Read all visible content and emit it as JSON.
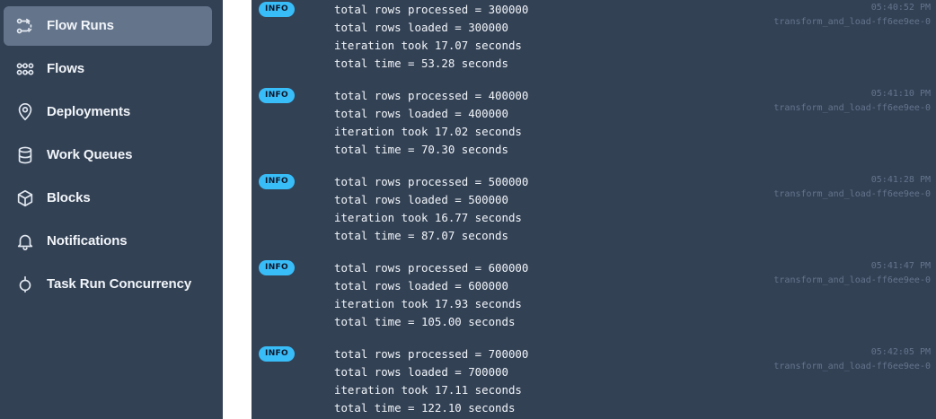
{
  "sidebar": {
    "items": [
      {
        "label": "Flow Runs",
        "icon": "flow-runs-icon",
        "active": true
      },
      {
        "label": "Flows",
        "icon": "flows-icon",
        "active": false
      },
      {
        "label": "Deployments",
        "icon": "map-pin-icon",
        "active": false
      },
      {
        "label": "Work Queues",
        "icon": "database-icon",
        "active": false
      },
      {
        "label": "Blocks",
        "icon": "cube-icon",
        "active": false
      },
      {
        "label": "Notifications",
        "icon": "bell-icon",
        "active": false
      },
      {
        "label": "Task Run Concurrency",
        "icon": "concurrency-icon",
        "active": false
      }
    ]
  },
  "colors": {
    "sidebar_bg": "#334155",
    "active_item_bg": "#64748b",
    "log_bg": "#334155",
    "badge_bg": "#38bdf8",
    "meta_text": "#64748b"
  },
  "logs": [
    {
      "level": "INFO",
      "time": "05:40:52 PM",
      "task": "transform_and_load-ff6ee9ee-0",
      "lines": [
        "total rows processed = 300000",
        "total rows loaded = 300000",
        "iteration took 17.07 seconds",
        "total time = 53.28 seconds"
      ]
    },
    {
      "level": "INFO",
      "time": "05:41:10 PM",
      "task": "transform_and_load-ff6ee9ee-0",
      "lines": [
        "total rows processed = 400000",
        "total rows loaded = 400000",
        "iteration took 17.02 seconds",
        "total time = 70.30 seconds"
      ]
    },
    {
      "level": "INFO",
      "time": "05:41:28 PM",
      "task": "transform_and_load-ff6ee9ee-0",
      "lines": [
        "total rows processed = 500000",
        "total rows loaded = 500000",
        "iteration took 16.77 seconds",
        "total time = 87.07 seconds"
      ]
    },
    {
      "level": "INFO",
      "time": "05:41:47 PM",
      "task": "transform_and_load-ff6ee9ee-0",
      "lines": [
        "total rows processed = 600000",
        "total rows loaded = 600000",
        "iteration took 17.93 seconds",
        "total time = 105.00 seconds"
      ]
    },
    {
      "level": "INFO",
      "time": "05:42:05 PM",
      "task": "transform_and_load-ff6ee9ee-0",
      "lines": [
        "total rows processed = 700000",
        "total rows loaded = 700000",
        "iteration took 17.11 seconds",
        "total time = 122.10 seconds"
      ]
    }
  ]
}
